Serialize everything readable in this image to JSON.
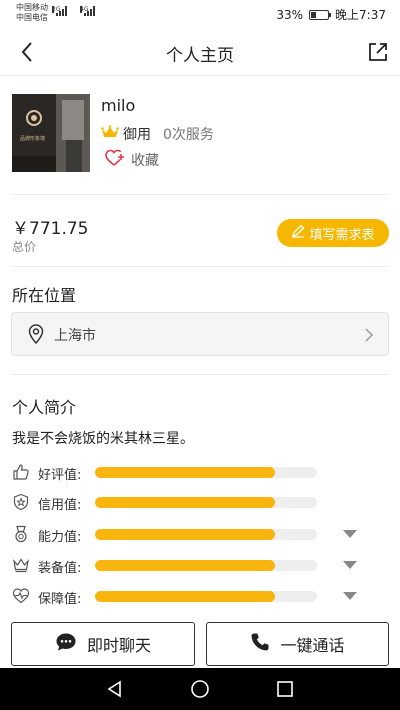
{
  "status_bar": {
    "carrier_1": "中国移动",
    "carrier_2": "中国电信",
    "signal_tag_1": "2G",
    "signal_tag_2": "4G",
    "battery_text": "33%",
    "battery_level": 0.33,
    "time": "晚上7:37"
  },
  "header": {
    "title": "个人主页",
    "back_icon": "back-arrow-icon",
    "share_icon": "share-icon"
  },
  "profile": {
    "name": "milo",
    "rank": "御用",
    "services": "0次服务",
    "favorite_label": "收藏",
    "avatar_caption": "品牌形象墙"
  },
  "price": {
    "value": "￥771.75",
    "label": "总价",
    "button": "填写需求表"
  },
  "location": {
    "title": "所在位置",
    "city": "上海市"
  },
  "intro": {
    "title": "个人简介",
    "text": "我是不会烧饭的米其林三星。"
  },
  "stats": [
    {
      "label": "好评值:",
      "value": 0.81
    },
    {
      "label": "信用值:",
      "value": 0.81
    },
    {
      "label": "能力值:",
      "value": 0.81
    },
    {
      "label": "装备值:",
      "value": 0.81
    },
    {
      "label": "保障值:",
      "value": 0.81
    }
  ],
  "actions": {
    "chat": "即时聊天",
    "call": "一键通话"
  },
  "colors": {
    "accent": "#f6b700",
    "bar_fill": "#f7b50d",
    "bar_track": "#eeeeee"
  }
}
